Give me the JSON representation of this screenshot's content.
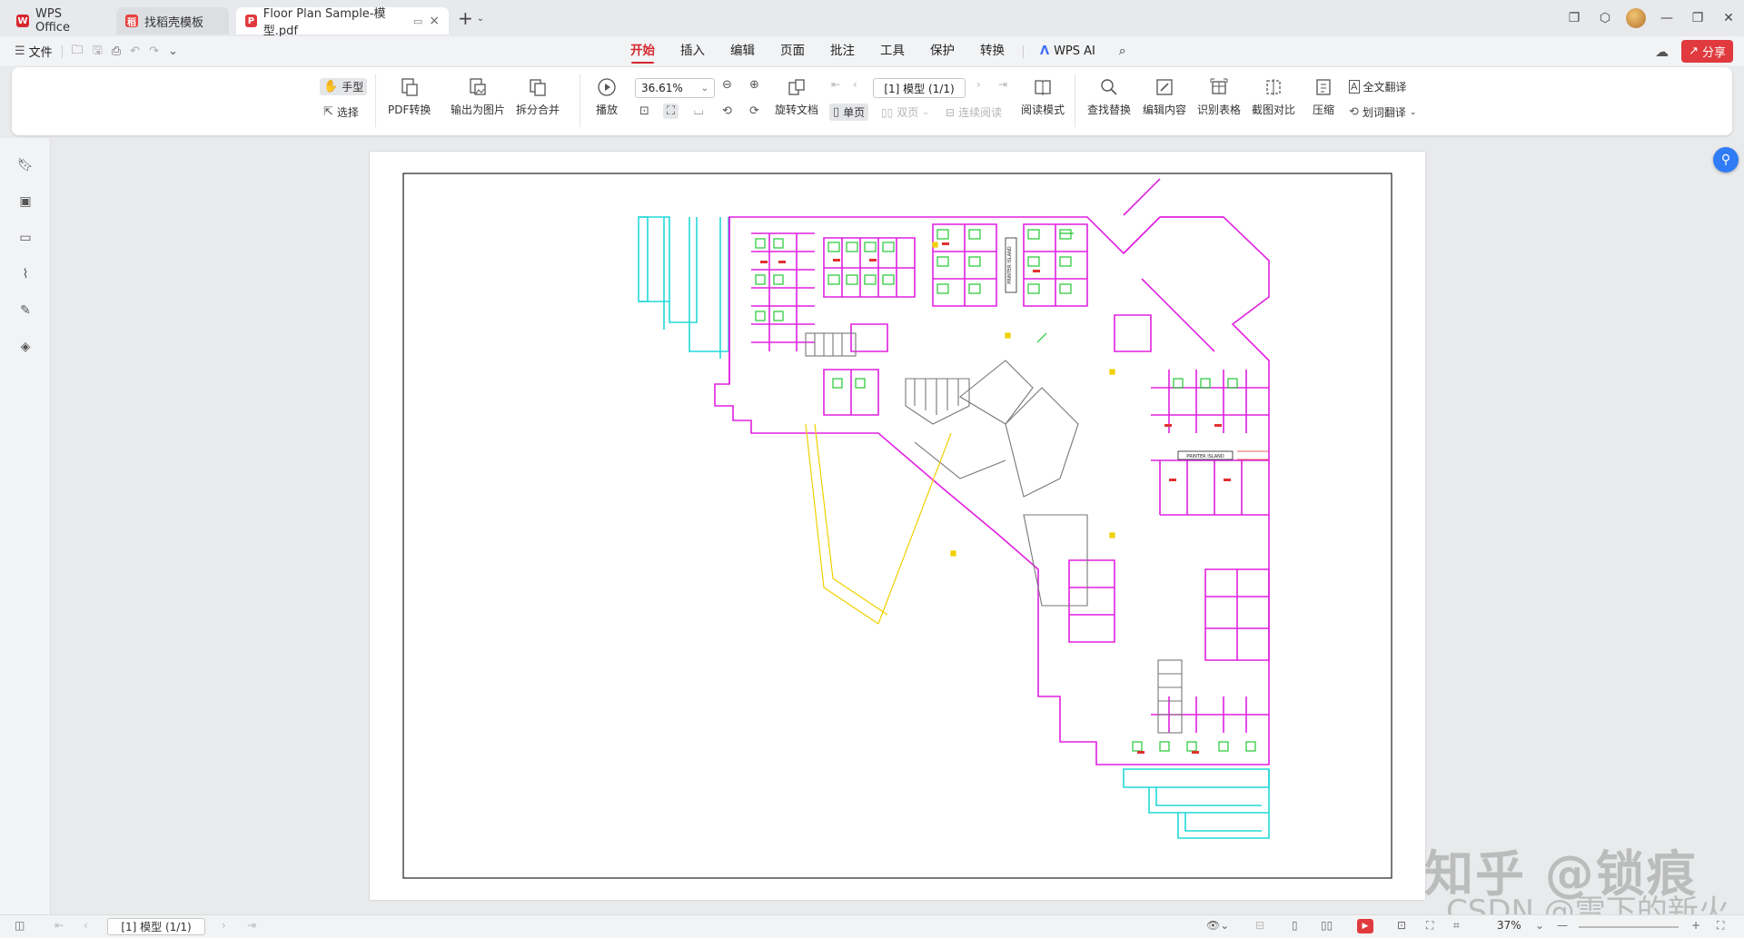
{
  "titlebar": {
    "tabs": [
      {
        "label": "WPS Office",
        "icon": "wps-logo-icon"
      },
      {
        "label": "找稻壳模板",
        "icon": "docer-icon"
      },
      {
        "label": "Floor Plan Sample-模型.pdf",
        "icon": "pdf-icon"
      }
    ],
    "new_tab": "+",
    "window_controls": [
      "restore-layout-icon",
      "cube-icon",
      "avatar",
      "minimize-icon",
      "maximize-icon",
      "close-icon"
    ]
  },
  "menubar": {
    "file_label": "文件",
    "tabs": [
      "开始",
      "插入",
      "编辑",
      "页面",
      "批注",
      "工具",
      "保护",
      "转换"
    ],
    "active_tab": "开始",
    "ai_label": "WPS AI",
    "share_label": "分享"
  },
  "ribbon": {
    "hand_label": "手型",
    "select_label": "选择",
    "pdf_convert_label": "PDF转换",
    "export_image_label": "输出为图片",
    "split_merge_label": "拆分合并",
    "play_label": "播放",
    "zoom_value": "36.61%",
    "page_value": "[1] 模型 (1/1)",
    "rotate_label": "旋转文档",
    "single_page_label": "单页",
    "double_page_label": "双页",
    "continuous_label": "连续阅读",
    "read_mode_label": "阅读模式",
    "find_replace_label": "查找替换",
    "edit_content_label": "编辑内容",
    "recognize_table_label": "识别表格",
    "screenshot_compare_label": "截图对比",
    "compress_label": "压缩",
    "full_translate_label": "全文翻译",
    "word_translate_label": "划词翻译"
  },
  "sidebar": {
    "icons": [
      "bookmark-icon",
      "thumbnail-icon",
      "comment-icon",
      "attachment-icon",
      "signature-icon",
      "layers-icon"
    ]
  },
  "page": {
    "drawing_labels": [
      "PRINTER ISLAND",
      "PRINTER ISLAND"
    ]
  },
  "watermark": {
    "main": "知乎 @锁痕",
    "sub": "CSDN @雪下的新火"
  },
  "statusbar": {
    "page_value": "[1] 模型 (1/1)",
    "zoom_value": "37%"
  },
  "colors": {
    "accent_red": "#d6272f",
    "share_red": "#e03a3e",
    "float_blue": "#2f7cf6",
    "wall_magenta": "#e020e0",
    "window_cyan": "#22d8d8",
    "furniture_green": "#22c833",
    "annotation_yellow": "#f0d000"
  }
}
